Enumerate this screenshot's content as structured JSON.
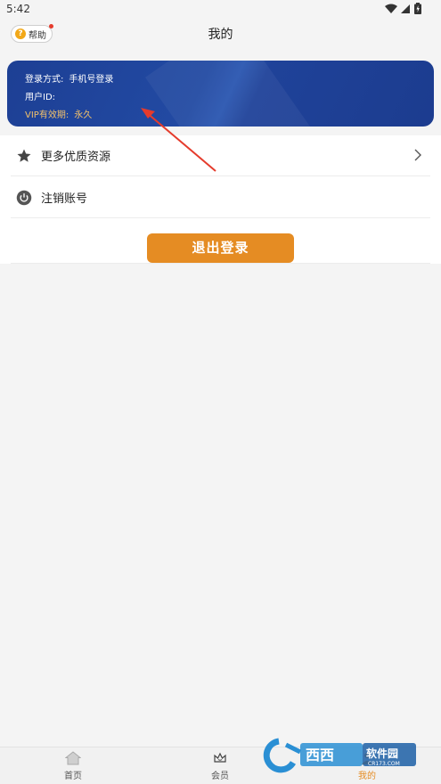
{
  "status_bar": {
    "time": "5:42"
  },
  "header": {
    "help_label": "帮助",
    "title": "我的"
  },
  "account_card": {
    "login_method_label": "登录方式:",
    "login_method_value": "手机号登录",
    "user_id_label": "用户ID:",
    "user_id_value": "",
    "vip_label": "VIP有效期:",
    "vip_value": "永久"
  },
  "menu": {
    "items": [
      {
        "label": "更多优质资源",
        "icon": "star-icon"
      },
      {
        "label": "注销账号",
        "icon": "power-icon"
      }
    ],
    "logout_label": "退出登录"
  },
  "tabbar": {
    "tabs": [
      {
        "label": "首页",
        "icon": "home-icon"
      },
      {
        "label": "会员",
        "icon": "vip-crown-icon"
      },
      {
        "label": "我的",
        "icon": "profile-icon"
      }
    ]
  },
  "colors": {
    "accent": "#e58c23",
    "card_blue": "#1d3f94",
    "vip_gold": "#f2c16a",
    "annotation_red": "#e53b2c"
  }
}
